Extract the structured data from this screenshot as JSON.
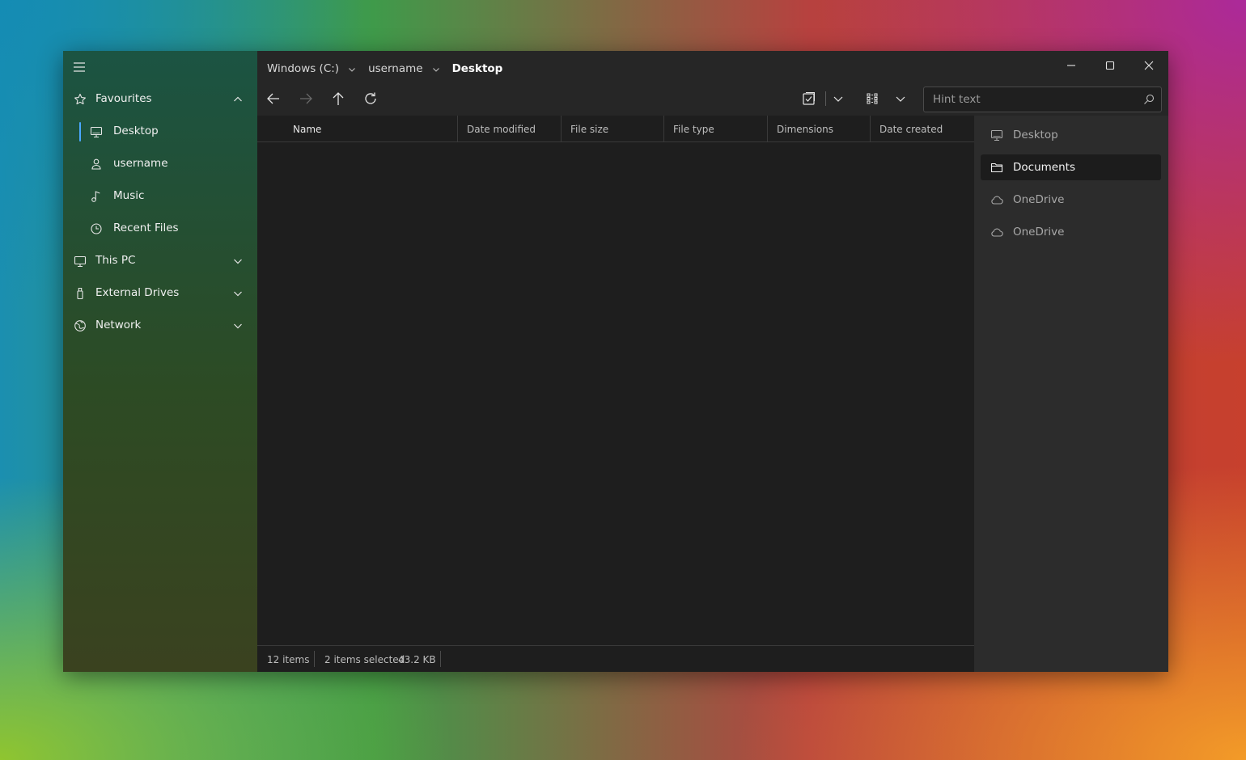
{
  "sidebar": {
    "items": [
      {
        "label": "Favourites",
        "icon": "star-icon",
        "expanded": true
      },
      {
        "label": "Desktop",
        "icon": "monitor-icon",
        "selected": true
      },
      {
        "label": "username",
        "icon": "user-icon"
      },
      {
        "label": "Music",
        "icon": "music-note-icon"
      },
      {
        "label": "Recent Files",
        "icon": "clock-icon"
      },
      {
        "label": "This PC",
        "icon": "monitor-icon",
        "expanded": false
      },
      {
        "label": "External Drives",
        "icon": "usb-drive-icon",
        "expanded": false
      },
      {
        "label": "Network",
        "icon": "globe-icon",
        "expanded": false
      }
    ]
  },
  "breadcrumb": {
    "items": [
      "Windows (C:)",
      "username",
      "Desktop"
    ]
  },
  "search": {
    "placeholder": "Hint text"
  },
  "columns": [
    "Name",
    "Date modified",
    "File size",
    "File type",
    "Dimensions",
    "Date created"
  ],
  "status": {
    "item_count": "12 items",
    "selection": "2 items selected",
    "selection_size": "43.2 KB"
  },
  "quick_access": {
    "items": [
      {
        "label": "Desktop",
        "icon": "monitor-icon"
      },
      {
        "label": "Documents",
        "icon": "folder-icon",
        "active": true
      },
      {
        "label": "OneDrive",
        "icon": "cloud-icon"
      },
      {
        "label": "OneDrive",
        "icon": "cloud-icon"
      }
    ]
  },
  "colors": {
    "accent": "#4aa8ff",
    "window_bg": "#262626",
    "file_pane_bg": "#1e1e1e",
    "right_pane_bg": "#2c2c2c"
  }
}
